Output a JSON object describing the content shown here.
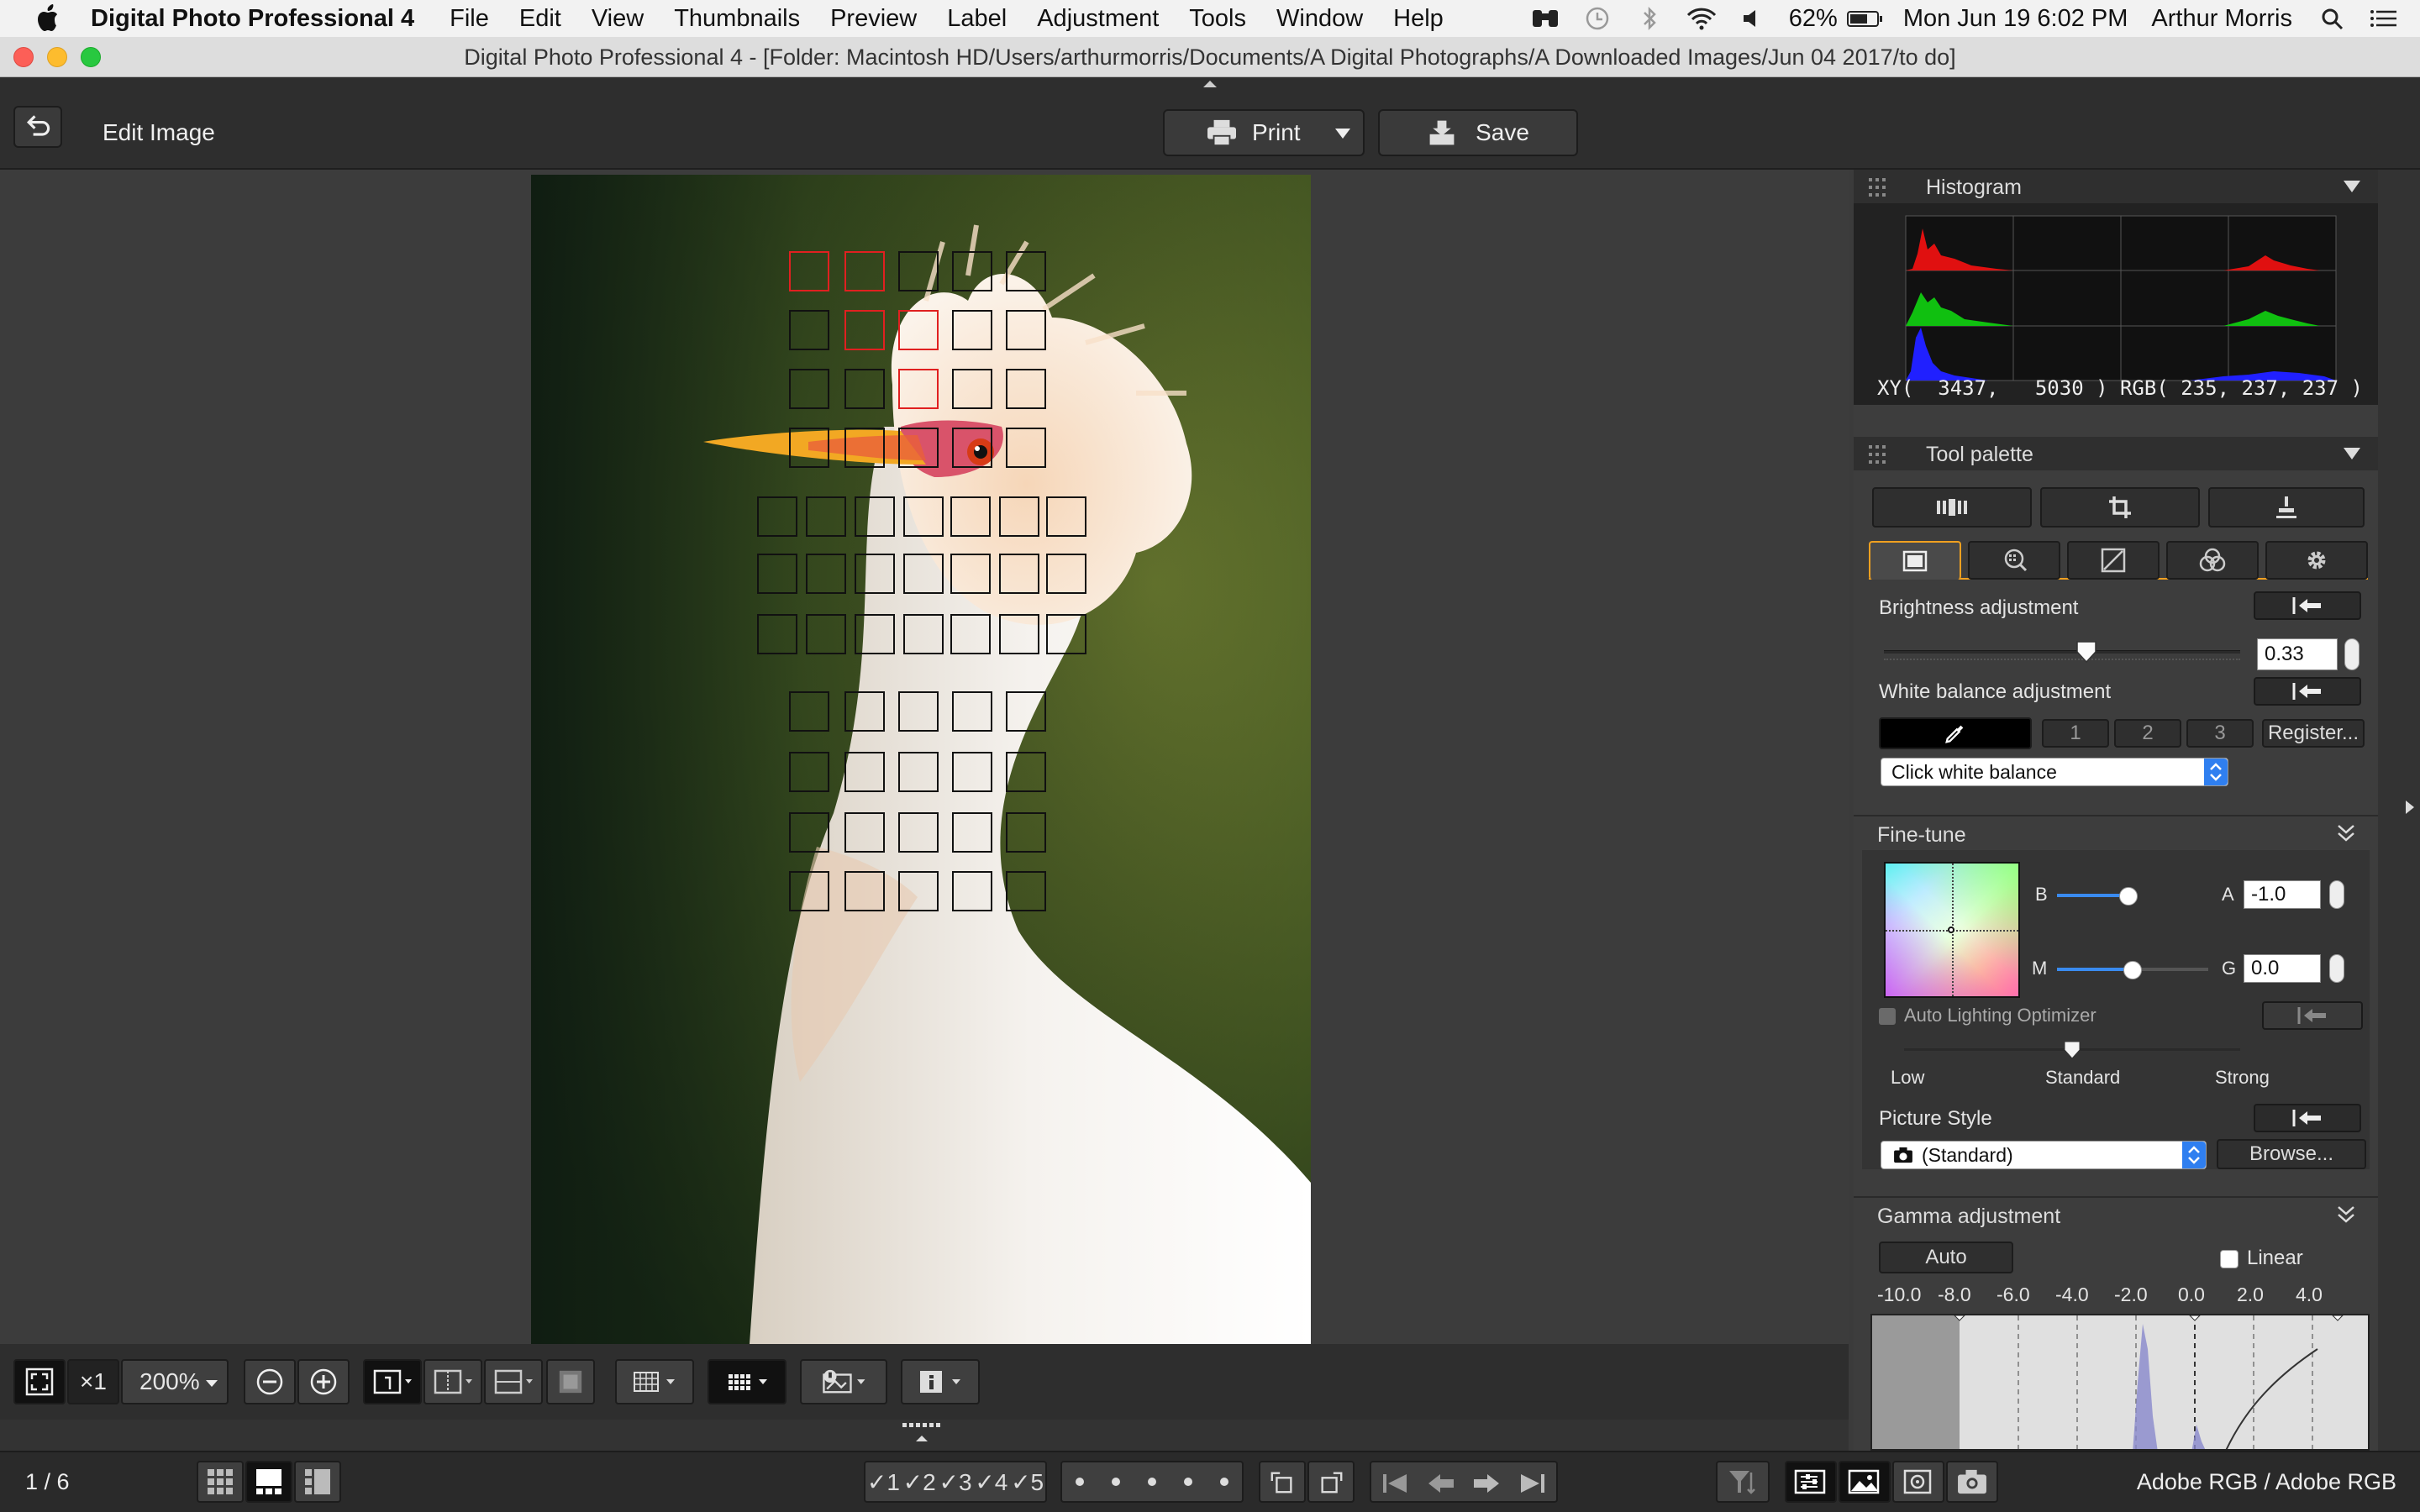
{
  "menubar": {
    "app_name": "Digital Photo Professional 4",
    "menus": [
      "File",
      "Edit",
      "View",
      "Thumbnails",
      "Preview",
      "Label",
      "Adjustment",
      "Tools",
      "Window",
      "Help"
    ],
    "battery": "62%",
    "datetime": "Mon Jun 19  6:02 PM",
    "user": "Arthur Morris"
  },
  "window": {
    "title": "Digital Photo Professional 4 - [Folder: Macintosh HD/Users/arthurmorris/Documents/A Digital Photographs/A Downloaded Images/Jun 04 2017/to do]"
  },
  "toolbar": {
    "mode_label": "Edit Image",
    "print_label": "Print",
    "save_label": "Save"
  },
  "histogram": {
    "header": "Histogram",
    "readout": "XY(  3437,   5030 ) RGB( 235, 237, 237 )"
  },
  "tool_palette": {
    "header": "Tool palette",
    "brightness": {
      "label": "Brightness adjustment",
      "value": "0.33",
      "slider_fraction": 0.57
    },
    "white_balance": {
      "label": "White balance adjustment",
      "presets": [
        "1",
        "2",
        "3"
      ],
      "register_label": "Register...",
      "selected": "Click white balance"
    }
  },
  "fine_tune": {
    "header": "Fine-tune",
    "b_label": "B",
    "a_label": "A",
    "ba_value": "-1.0",
    "ba_fraction": 0.47,
    "m_label": "M",
    "g_label": "G",
    "mg_value": "0.0",
    "mg_fraction": 0.5,
    "alo": {
      "label": "Auto Lighting Optimizer",
      "levels": [
        "Low",
        "Standard",
        "Strong"
      ]
    },
    "picture_style": {
      "label": "Picture Style",
      "selected": "(Standard)",
      "browse_label": "Browse..."
    }
  },
  "gamma": {
    "header": "Gamma adjustment",
    "auto_label": "Auto",
    "linear_label": "Linear",
    "scale": [
      "-10.0",
      "-8.0",
      "-6.0",
      "-4.0",
      "-2.0",
      "0.0",
      "2.0",
      "4.0"
    ]
  },
  "navbar": {
    "fit_label": "⛶",
    "x1_label": "×1",
    "zoom": "200%"
  },
  "filmbar": {
    "page": "1 / 6",
    "ratings": [
      "1",
      "2",
      "3",
      "4",
      "5"
    ],
    "color_space": "Adobe RGB / Adobe RGB"
  },
  "colors": {
    "accent": "#f0a020",
    "menubar_bg": "#f2f2f2",
    "app_bg": "#3b3b3b",
    "af_active": "#e02020",
    "hist_red": "#e01010",
    "hist_green": "#10c010",
    "hist_blue": "#2020ff"
  }
}
